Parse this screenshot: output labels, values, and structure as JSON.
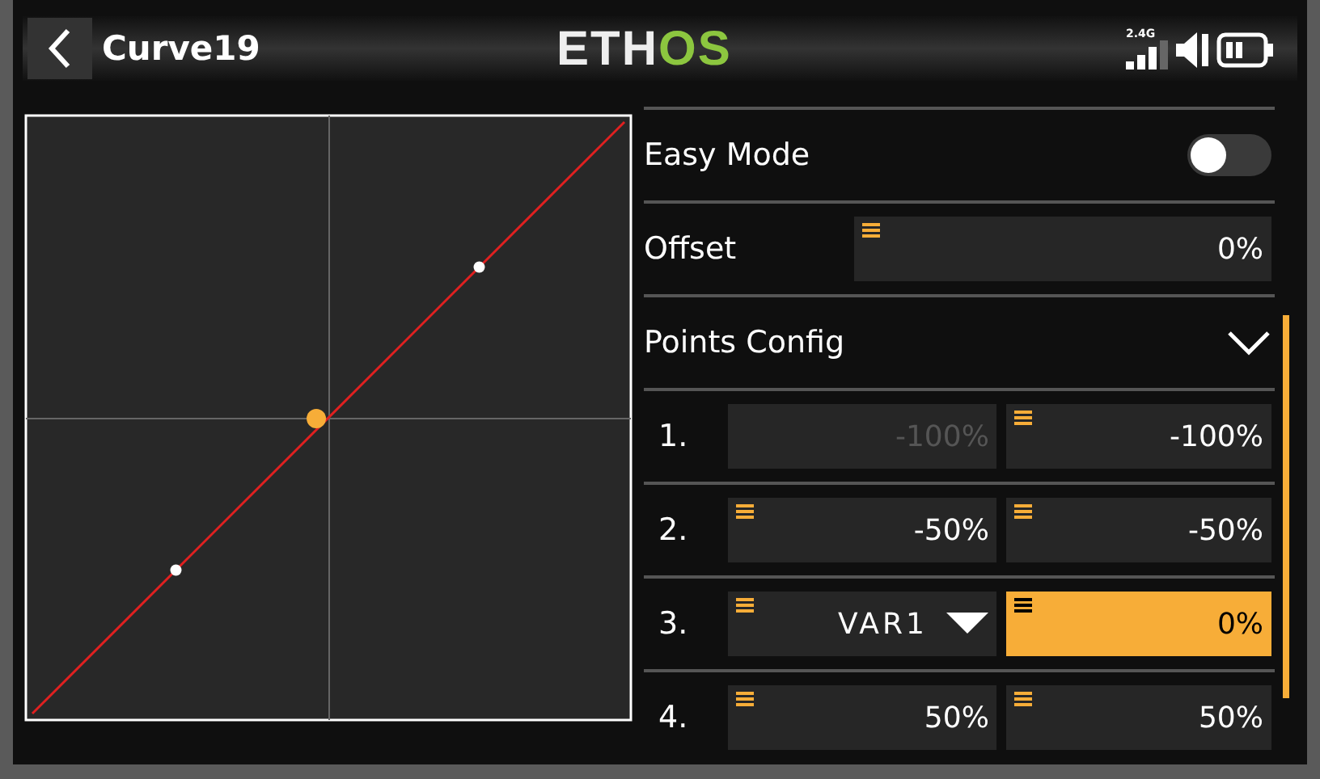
{
  "header": {
    "title": "Curve19",
    "logo": {
      "left": "ETH",
      "right": "OS"
    },
    "signal_label": "2.4G"
  },
  "settings": [
    {
      "kind": "toggle",
      "label": "Easy Mode",
      "on": false
    },
    {
      "kind": "value",
      "label": "Offset",
      "value": "0%"
    },
    {
      "kind": "collapse",
      "label": "Points Config",
      "expanded": true
    }
  ],
  "points": [
    {
      "label": "1.",
      "x": {
        "kind": "number",
        "value": "-100%",
        "disabled": true
      },
      "y": {
        "value": "-100%",
        "selected": false
      }
    },
    {
      "label": "2.",
      "x": {
        "kind": "number",
        "value": "-50%",
        "disabled": false
      },
      "y": {
        "value": "-50%",
        "selected": false
      }
    },
    {
      "label": "3.",
      "x": {
        "kind": "dropdown",
        "value": "VAR1",
        "disabled": false
      },
      "y": {
        "value": "0%",
        "selected": true
      }
    },
    {
      "label": "4.",
      "x": {
        "kind": "number",
        "value": "50%",
        "disabled": false
      },
      "y": {
        "value": "50%",
        "selected": false
      }
    }
  ]
}
